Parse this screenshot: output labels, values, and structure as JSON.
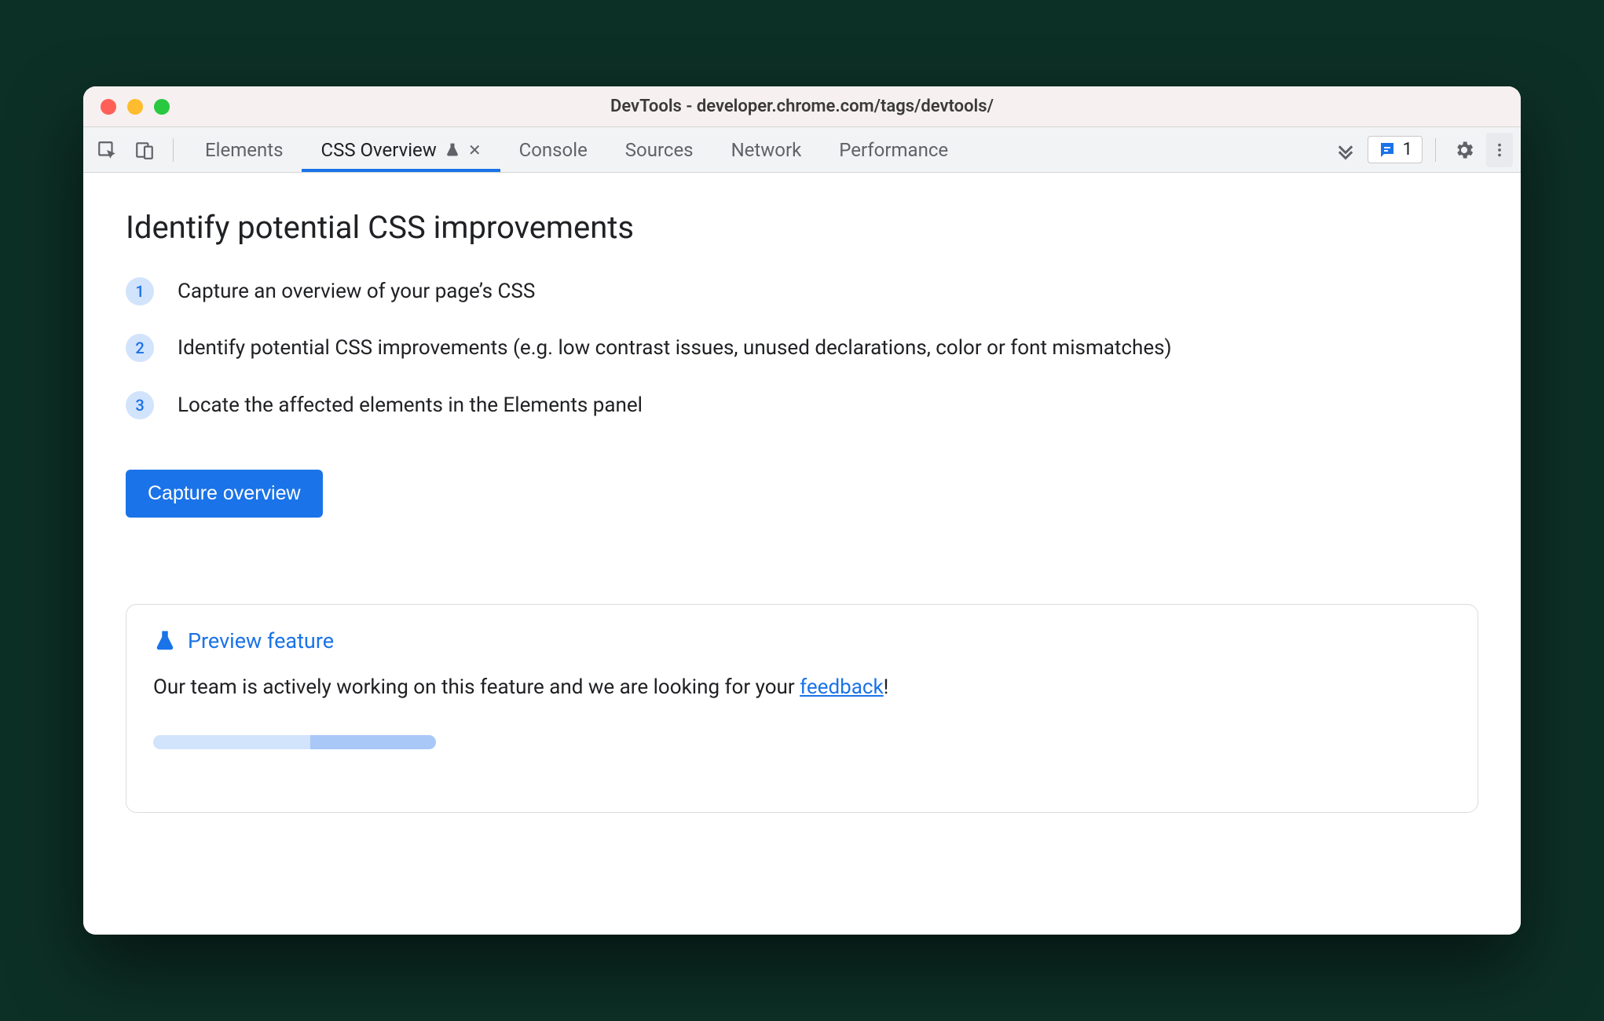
{
  "window": {
    "title": "DevTools - developer.chrome.com/tags/devtools/"
  },
  "tabs": {
    "items": [
      {
        "label": "Elements",
        "active": false
      },
      {
        "label": "CSS Overview",
        "active": true,
        "experimental": true,
        "closable": true
      },
      {
        "label": "Console",
        "active": false
      },
      {
        "label": "Sources",
        "active": false
      },
      {
        "label": "Network",
        "active": false
      },
      {
        "label": "Performance",
        "active": false
      }
    ]
  },
  "issues": {
    "count": "1"
  },
  "main": {
    "heading": "Identify potential CSS improvements",
    "steps": [
      "Capture an overview of your page’s CSS",
      "Identify potential CSS improvements (e.g. low contrast issues, unused declarations, color or font mismatches)",
      "Locate the affected elements in the Elements panel"
    ],
    "capture_button": "Capture overview"
  },
  "preview": {
    "title": "Preview feature",
    "body_pre": "Our team is actively working on this feature and we are looking for your ",
    "link": "feedback",
    "body_post": "!"
  }
}
